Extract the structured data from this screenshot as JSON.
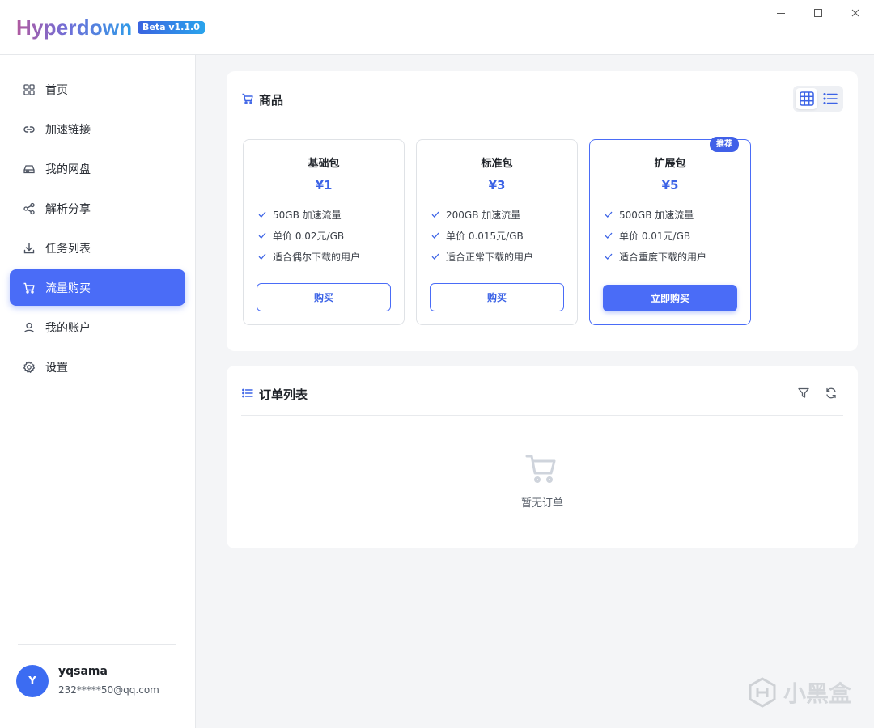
{
  "app": {
    "brand": "Hyperdown",
    "version_badge": "Beta v1.1.0"
  },
  "window_controls": [
    "minimize",
    "maximize",
    "close"
  ],
  "sidebar": {
    "items": [
      {
        "label": "首页",
        "icon": "grid-icon"
      },
      {
        "label": "加速链接",
        "icon": "link-icon"
      },
      {
        "label": "我的网盘",
        "icon": "drive-icon"
      },
      {
        "label": "解析分享",
        "icon": "share-icon"
      },
      {
        "label": "任务列表",
        "icon": "download-icon"
      },
      {
        "label": "流量购买",
        "icon": "cart-icon",
        "active": true
      },
      {
        "label": "我的账户",
        "icon": "user-icon"
      },
      {
        "label": "设置",
        "icon": "gear-icon"
      }
    ],
    "user": {
      "avatar_letter": "Y",
      "name": "yqsama",
      "email": "232*****50@qq.com"
    }
  },
  "products": {
    "title": "商品",
    "view_mode": "grid",
    "cards": [
      {
        "name": "基础包",
        "price": "¥1",
        "features": [
          "50GB 加速流量",
          "单价 0.02元/GB",
          "适合偶尔下载的用户"
        ],
        "button": "购买",
        "featured": false
      },
      {
        "name": "标准包",
        "price": "¥3",
        "features": [
          "200GB 加速流量",
          "单价 0.015元/GB",
          "适合正常下载的用户"
        ],
        "button": "购买",
        "featured": false
      },
      {
        "name": "扩展包",
        "price": "¥5",
        "features": [
          "500GB 加速流量",
          "单价 0.01元/GB",
          "适合重度下载的用户"
        ],
        "button": "立即购买",
        "featured": true,
        "badge": "推荐"
      }
    ]
  },
  "orders": {
    "title": "订单列表",
    "empty_text": "暂无订单"
  },
  "watermark": "小黑盒",
  "colors": {
    "accent": "#4a6cf7",
    "price": "#3c63e6",
    "avatar": "#3c6cf2"
  }
}
